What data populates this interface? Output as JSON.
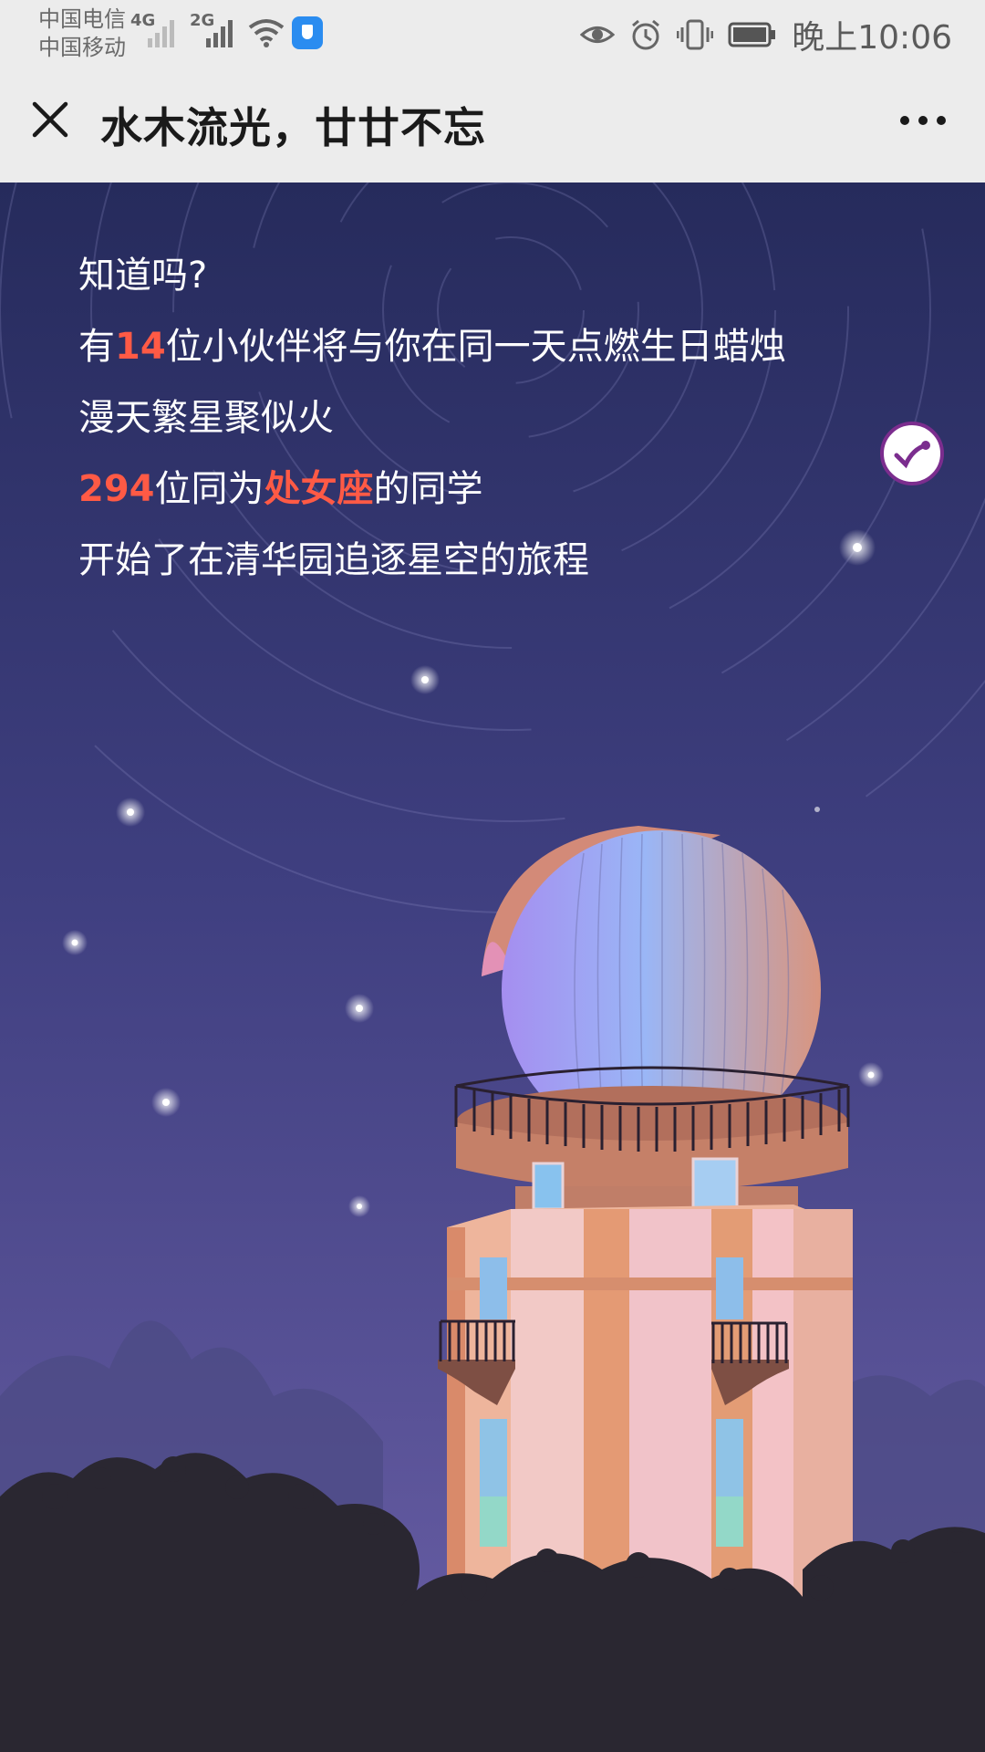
{
  "status_bar": {
    "carrier_1": "中国电信",
    "carrier_2": "中国移动",
    "net_1": "4G",
    "net_2": "2G",
    "time": "晚上10:06"
  },
  "nav": {
    "title": "水木流光，廿廿不忘"
  },
  "content": {
    "line1": "知道吗?",
    "line2_count": "14",
    "line2_text": "位小伙伴将与你在同一天点燃生日蜡烛",
    "line2_prefix": "有",
    "line3": "漫天繁星聚似火",
    "line4_count": "294",
    "line4_mid": "位同为",
    "line4_sign": "处女座",
    "line4_end": "的同学",
    "line5": "开始了在清华园追逐星空的旅程"
  },
  "colors": {
    "highlight": "#ff5a45",
    "sky_top": "#262b5c",
    "sky_bottom": "#6a5fa6",
    "music_ring": "#7b2d8e"
  },
  "icons": [
    "close-icon",
    "more-icon",
    "music-icon",
    "eye-icon",
    "alarm-icon",
    "vibrate-icon",
    "battery-icon",
    "wifi-icon",
    "signal-icon",
    "shield-icon"
  ]
}
